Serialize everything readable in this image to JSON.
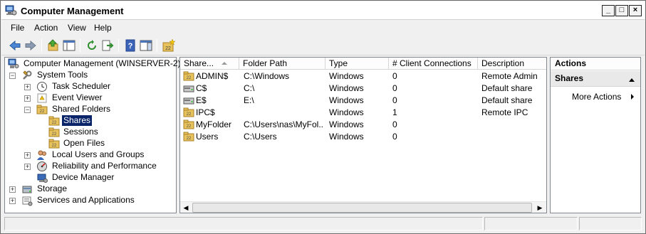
{
  "window": {
    "title": "Computer Management"
  },
  "menu": [
    "File",
    "Action",
    "View",
    "Help"
  ],
  "toolbar": {
    "buttons": [
      "back-icon",
      "forward-icon",
      "up-icon",
      "show-hide-tree-icon",
      "refresh-icon",
      "export-list-icon",
      "help-icon",
      "show-hide-action-pane-icon",
      "new-share-icon"
    ]
  },
  "tree": {
    "root": "Computer Management (WINSERVER-2)",
    "system_tools": "System Tools",
    "task_scheduler": "Task Scheduler",
    "event_viewer": "Event Viewer",
    "shared_folders": "Shared Folders",
    "shares": "Shares",
    "sessions": "Sessions",
    "open_files": "Open Files",
    "local_users": "Local Users and Groups",
    "reliability": "Reliability and Performance",
    "device_manager": "Device Manager",
    "storage": "Storage",
    "services": "Services and Applications"
  },
  "list": {
    "columns": [
      "Share...",
      "Folder Path",
      "Type",
      "# Client Connections",
      "Description"
    ],
    "rows": [
      {
        "share": "ADMIN$",
        "path": "C:\\Windows",
        "type": "Windows",
        "connections": "0",
        "description": "Remote Admin"
      },
      {
        "share": "C$",
        "path": "C:\\",
        "type": "Windows",
        "connections": "0",
        "description": "Default share"
      },
      {
        "share": "E$",
        "path": "E:\\",
        "type": "Windows",
        "connections": "0",
        "description": "Default share"
      },
      {
        "share": "IPC$",
        "path": "",
        "type": "Windows",
        "connections": "1",
        "description": "Remote IPC"
      },
      {
        "share": "MyFolder",
        "path": "C:\\Users\\nas\\MyFol...",
        "type": "Windows",
        "connections": "0",
        "description": ""
      },
      {
        "share": "Users",
        "path": "C:\\Users",
        "type": "Windows",
        "connections": "0",
        "description": ""
      }
    ]
  },
  "actions": {
    "header": "Actions",
    "section": "Shares",
    "more_actions": "More Actions"
  }
}
